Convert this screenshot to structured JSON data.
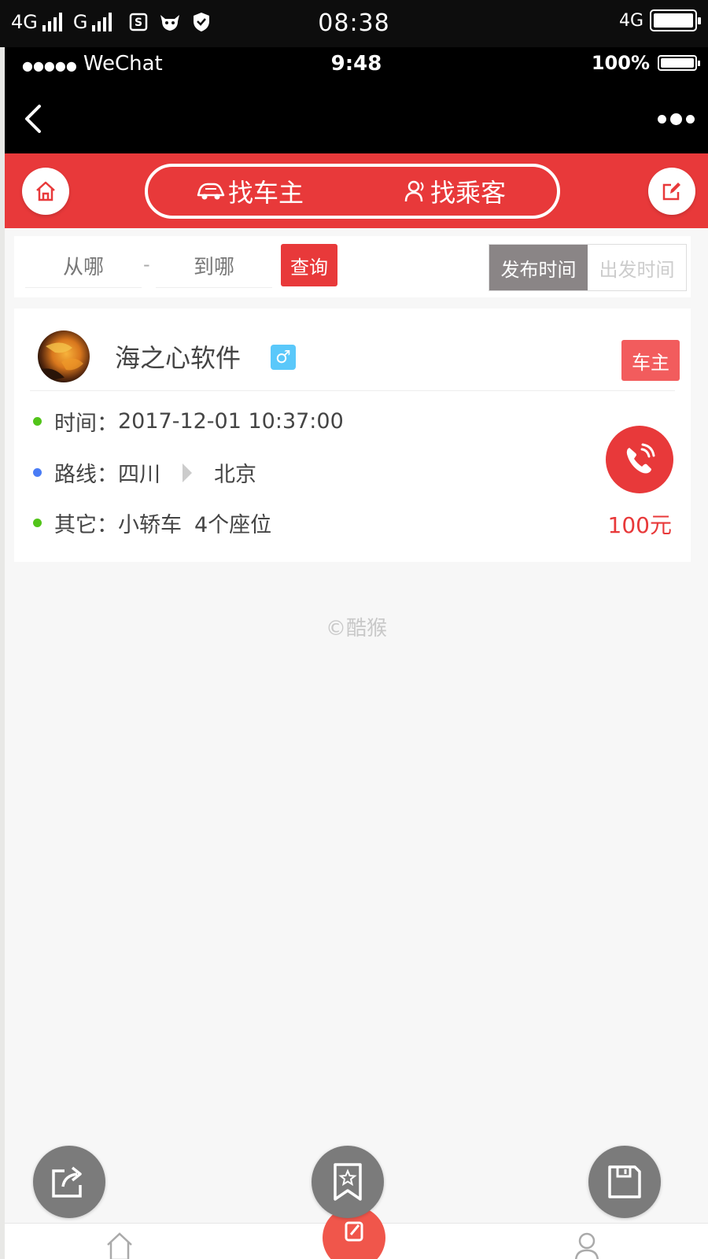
{
  "android_status": {
    "network1": "4G",
    "network2": "G",
    "time": "08:38",
    "network_right": "4G"
  },
  "ios_status": {
    "carrier": "WeChat",
    "time": "9:48",
    "battery": "100%"
  },
  "header": {
    "tab_find_driver": "找车主",
    "tab_find_passenger": "找乘客"
  },
  "search": {
    "from_placeholder": "从哪",
    "separator": "-",
    "to_placeholder": "到哪",
    "query_label": "查询",
    "sort_publish": "发布时间",
    "sort_departure": "出发时间",
    "active_sort": "发布时间"
  },
  "listing": {
    "user_name": "海之心软件",
    "gender_symbol": "♂",
    "role": "车主",
    "time_label": "时间：",
    "time_value": "2017-12-01 10:37:00",
    "route_label": "路线：",
    "route_from": "四川",
    "route_to": "北京",
    "other_label": "其它：",
    "vehicle": "小轿车",
    "seats": "4个座位",
    "price": "100元"
  },
  "footer": {
    "copyright": "©酷猴"
  },
  "colors": {
    "brand_red": "#e8393a",
    "badge_red": "#f25c5d",
    "gender_blue": "#5ac8fa",
    "dot_green": "#52c41a",
    "dot_blue": "#4a7cf5"
  },
  "icons": {
    "home": "home-icon",
    "edit": "edit-icon",
    "car": "car-icon",
    "passenger": "passenger-icon",
    "phone": "phone-icon",
    "share": "share-icon",
    "bookmark": "bookmark-star-icon",
    "save": "save-icon",
    "user": "user-icon"
  }
}
